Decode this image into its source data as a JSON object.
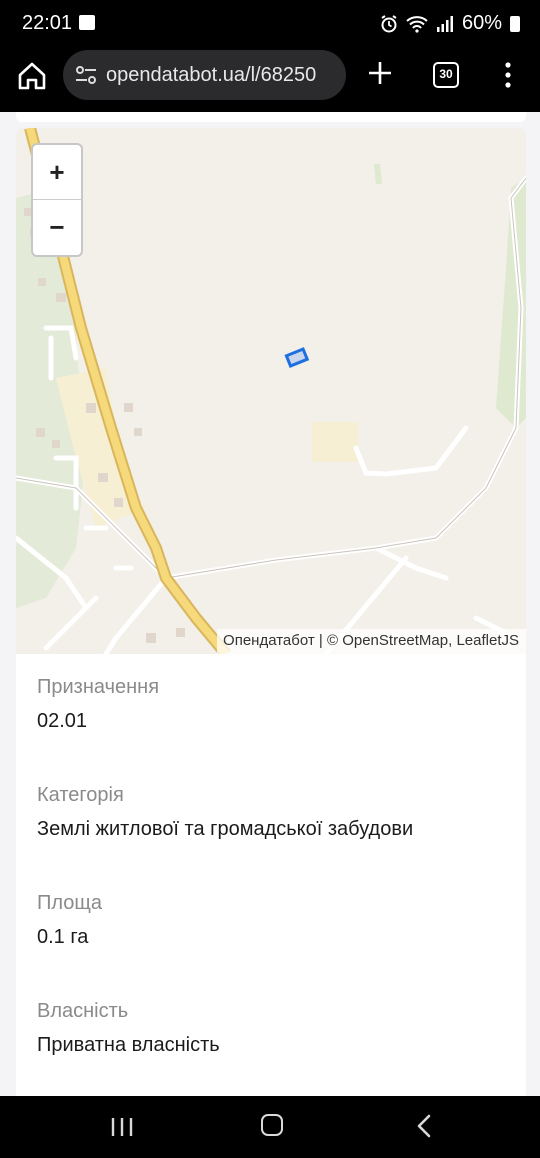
{
  "status": {
    "time": "22:01",
    "battery": "60%",
    "icons": [
      "gallery-icon",
      "alarm-icon",
      "wifi-icon",
      "signal-icon",
      "battery-icon"
    ]
  },
  "browser": {
    "url": "opendatabot.ua/l/68250",
    "tab_count": "30",
    "icons": [
      "home-icon",
      "site-settings-icon",
      "new-tab-icon",
      "tabs-icon",
      "menu-icon"
    ]
  },
  "map": {
    "zoom_in": "+",
    "zoom_out": "−",
    "attribution_sep": " | © ",
    "attribution_a": "Опендатабот",
    "attribution_b": "OpenStreetMap",
    "attribution_c": ", ",
    "attribution_d": "LeafletJS",
    "colors": {
      "road_major": "#f5d97a",
      "road_major_casing": "#d9b65c",
      "parcel": "#1e6fe0",
      "land": "#f3efe9",
      "greenery": "#dfe9d0"
    }
  },
  "details": [
    {
      "label": "Призначення",
      "value": "02.01"
    },
    {
      "label": "Категорія",
      "value": "Землі житлової та громадської забудови"
    },
    {
      "label": "Площа",
      "value": "0.1 га"
    },
    {
      "label": "Власність",
      "value": "Приватна власність"
    }
  ],
  "nav": {
    "icons": [
      "recent-apps-icon",
      "home-button-icon",
      "back-icon"
    ]
  }
}
